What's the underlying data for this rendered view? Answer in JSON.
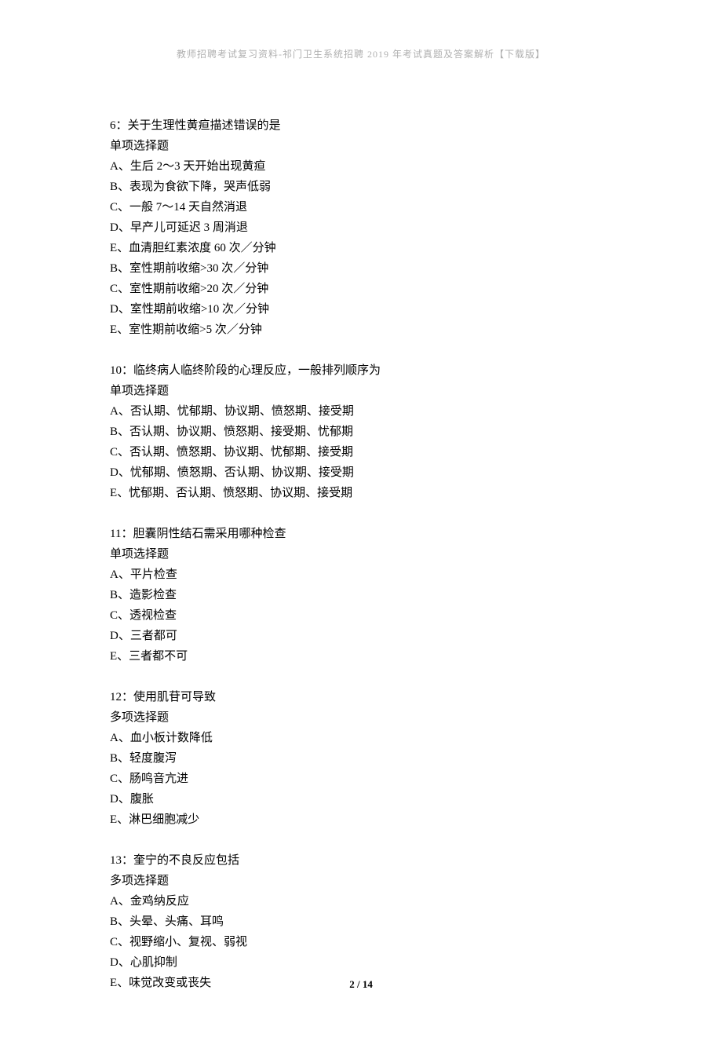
{
  "header": "教师招聘考试复习资料-祁门卫生系统招聘 2019 年考试真题及答案解析【下载版】",
  "questions": [
    {
      "number": "6",
      "stem": "关于生理性黄疸描述错误的是",
      "type": "单项选择题",
      "options": [
        "A、生后 2～3 天开始出现黄疸",
        "B、表现为食欲下降，哭声低弱",
        "C、一般 7～14 天自然消退",
        "D、早产儿可延迟 3 周消退",
        "E、血清胆红素浓度 60 次／分钟",
        "B、室性期前收缩>30 次／分钟",
        "C、室性期前收缩>20 次／分钟",
        "D、室性期前收缩>10 次／分钟",
        "E、室性期前收缩>5 次／分钟"
      ]
    },
    {
      "number": "10",
      "stem": "临终病人临终阶段的心理反应，一般排列顺序为",
      "type": "单项选择题",
      "options": [
        "A、否认期、忧郁期、协议期、愤怒期、接受期",
        "B、否认期、协议期、愤怒期、接受期、忧郁期",
        "C、否认期、愤怒期、协议期、忧郁期、接受期",
        "D、忧郁期、愤怒期、否认期、协议期、接受期",
        "E、忧郁期、否认期、愤怒期、协议期、接受期"
      ]
    },
    {
      "number": "11",
      "stem": "胆囊阴性结石需采用哪种检查",
      "type": "单项选择题",
      "options": [
        "A、平片检查",
        "B、造影检查",
        "C、透视检查",
        "D、三者都可",
        "E、三者都不可"
      ]
    },
    {
      "number": "12",
      "stem": "使用肌苷可导致",
      "type": "多项选择题",
      "options": [
        "A、血小板计数降低",
        "B、轻度腹泻",
        "C、肠鸣音亢进",
        "D、腹胀",
        "E、淋巴细胞减少"
      ]
    },
    {
      "number": "13",
      "stem": "奎宁的不良反应包括",
      "type": "多项选择题",
      "options": [
        "A、金鸡纳反应",
        "B、头晕、头痛、耳鸣",
        "C、视野缩小、复视、弱视",
        "D、心肌抑制",
        "E、味觉改变或丧失"
      ]
    }
  ],
  "footer": {
    "page": "2",
    "sep": " / ",
    "total": "14"
  }
}
